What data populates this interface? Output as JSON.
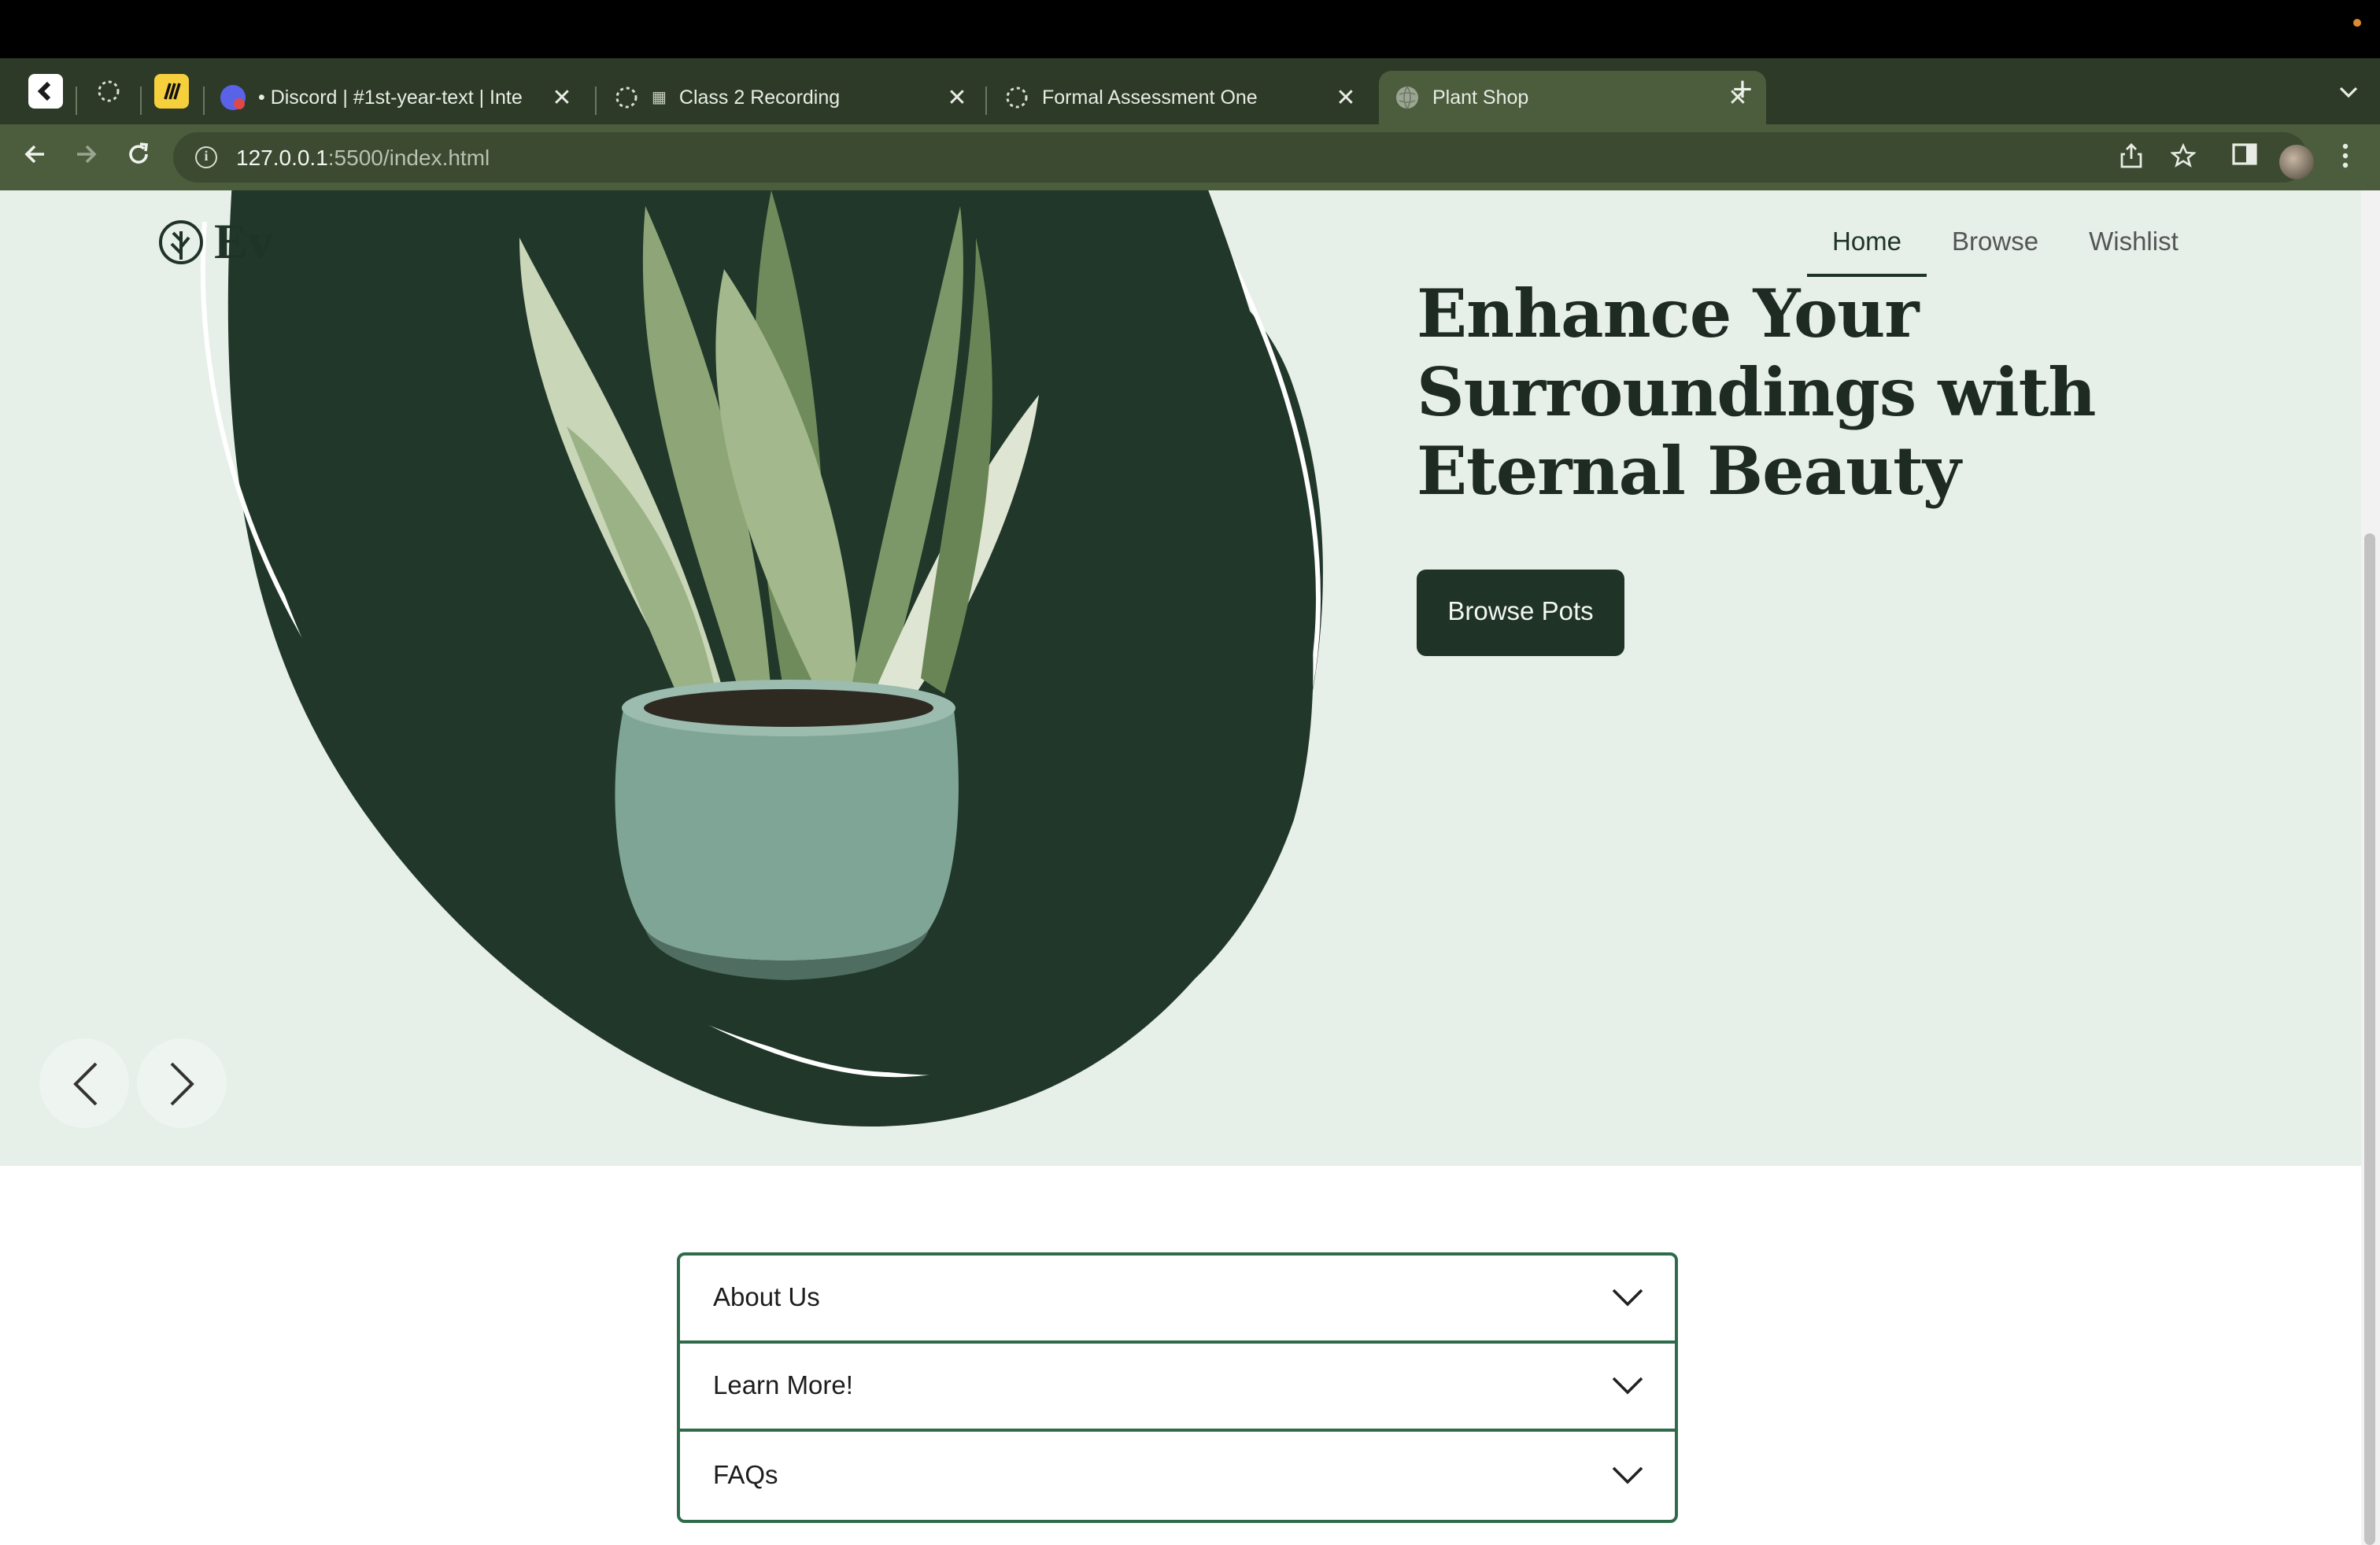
{
  "browser": {
    "tabs": [
      {
        "title": "• Discord | #1st-year-text | Inte",
        "close": "✕"
      },
      {
        "title": "Class 2 Recording",
        "close": "✕"
      },
      {
        "title": "Formal Assessment One",
        "close": "✕"
      },
      {
        "title": "Plant Shop",
        "close": "✕",
        "active": true
      }
    ],
    "new_tab": "+",
    "url_host": "127.0.0.1",
    "url_path": ":5500/index.html"
  },
  "site": {
    "logo_text": "Ev",
    "nav": [
      "Home",
      "Browse",
      "Wishlist"
    ],
    "hero_title": "Enhance Your Surroundings with Eternal Beauty",
    "cta": "Browse Pots",
    "accordion": [
      "About Us",
      "Learn More!",
      "FAQs"
    ]
  },
  "colors": {
    "hero_bg": "#e6efe8",
    "blob": "#20372a",
    "accent": "#1f3326",
    "accordion_border": "#2f6b4b",
    "tabstrip": "#2d3a27",
    "toolbar": "#4b5d3c"
  }
}
